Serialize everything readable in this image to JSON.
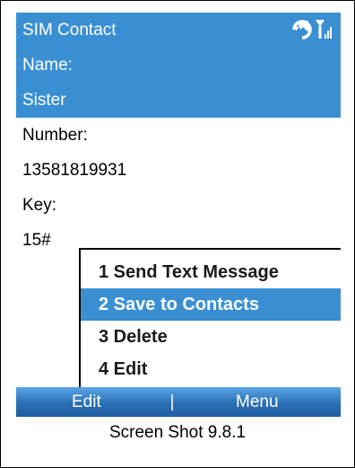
{
  "app": {
    "title": "SIM Contact"
  },
  "colors": {
    "highlight": "#3a8fd3",
    "softkey_bar": "#2a6fb5"
  },
  "status_icons": [
    "connectivity-icon",
    "signal-strength-icon"
  ],
  "fields": {
    "name_label": "Name:",
    "name_value": "Sister",
    "number_label": "Number:",
    "number_value": "13581819931",
    "key_label": "Key:",
    "key_value": "15#"
  },
  "menu": {
    "items": [
      {
        "label": "1 Send Text Message"
      },
      {
        "label": "2 Save to Contacts",
        "selected": true
      },
      {
        "label": "3 Delete"
      },
      {
        "label": "4 Edit"
      }
    ]
  },
  "softkeys": {
    "left": "Edit",
    "right": "Menu"
  },
  "caption": "Screen Shot 9.8.1"
}
